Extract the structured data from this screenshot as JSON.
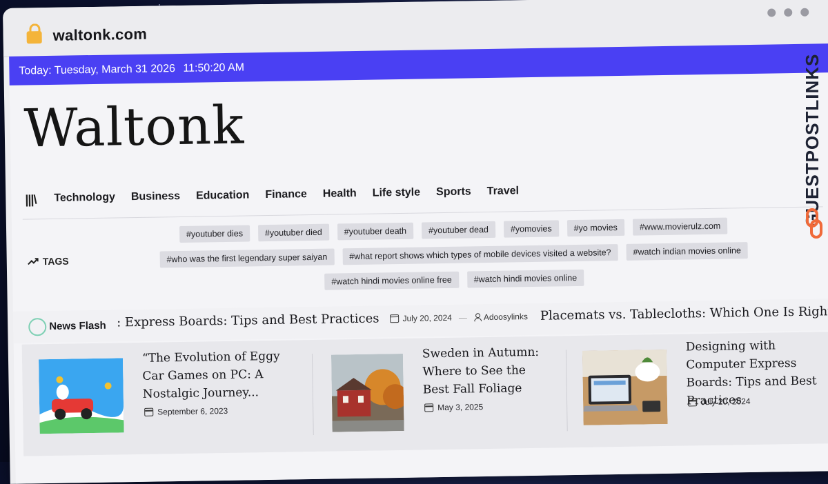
{
  "browser": {
    "url": "waltonk.com"
  },
  "topbar": {
    "date": "Today: Tuesday, March 31 2026",
    "time": "11:50:20 AM"
  },
  "site": {
    "logo": "Waltonk"
  },
  "nav": {
    "items": [
      "Technology",
      "Business",
      "Education",
      "Finance",
      "Health",
      "Life style",
      "Sports",
      "Travel"
    ]
  },
  "tags": {
    "label": "TAGS",
    "rows": [
      [
        "#youtuber dies",
        "#youtuber died",
        "#youtuber death",
        "#youtuber dead",
        "#yomovies",
        "#yo movies",
        "#www.movierulz.com"
      ],
      [
        "#who was the first legendary super saiyan",
        "#what report shows which types of mobile devices visited a website?",
        "#watch indian movies online"
      ],
      [
        "#watch hindi movies online free",
        "#watch hindi movies online"
      ]
    ]
  },
  "news_flash": {
    "label": "News Flash",
    "ticker_title": ": Express Boards: Tips and Best Practices",
    "ticker_date": "July 20, 2024",
    "ticker_author": "Adoosylinks",
    "next_title": "Placemats vs. Tablecloths: Which One Is Right for Your Di"
  },
  "cards": [
    {
      "title": "“The Evolution of Eggy Car Games on PC: A Nostalgic Journey...",
      "date": "September 6, 2023"
    },
    {
      "title": "Sweden in Autumn: Where to See the Best Fall Foliage",
      "date": "May 3, 2025"
    },
    {
      "title": "Designing with Computer Express Boards: Tips and Best Practices",
      "date": "July 20, 2024"
    }
  ],
  "brand": {
    "name": "GUESTPOSTLINKS"
  },
  "colors": {
    "topbar": "#4a40f3",
    "accent_ring": "#7ed0b4",
    "brand_icon": "#f06a3a"
  }
}
